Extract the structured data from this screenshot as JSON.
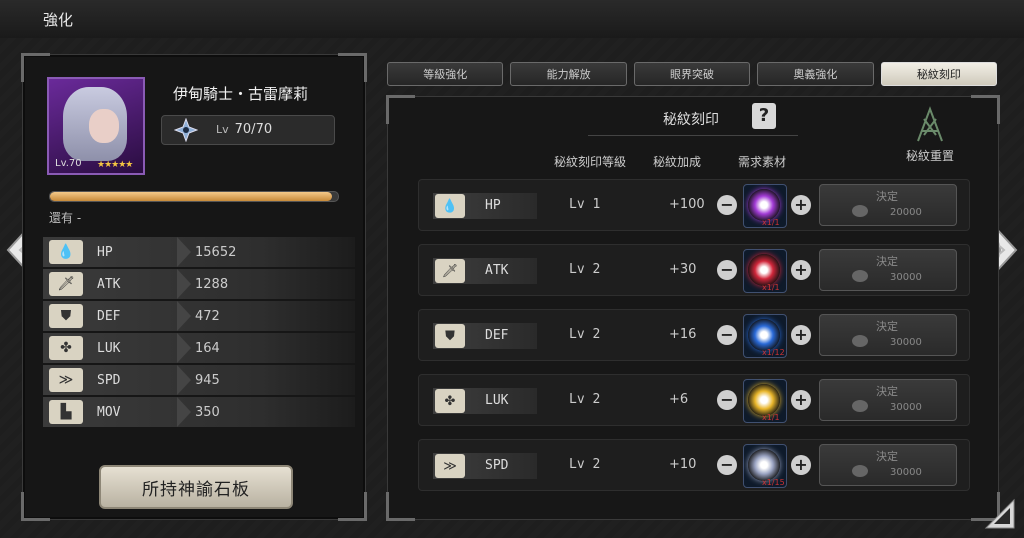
{
  "header": {
    "title": "強化"
  },
  "character": {
    "name": "伊甸騎士・古雷摩莉",
    "portrait_level": "Lv.70",
    "stars": "★★★★★",
    "level_prefix": "Lv",
    "level": "70/70",
    "xp_fraction": 0.98,
    "remain_label": "還有 -"
  },
  "stats": [
    {
      "icon": "hp-drop-icon",
      "glyph": "💧",
      "label": "HP",
      "value": "15652"
    },
    {
      "icon": "atk-sword-icon",
      "glyph": "🗡",
      "label": "ATK",
      "value": "1288"
    },
    {
      "icon": "def-shield-icon",
      "glyph": "⛊",
      "label": "DEF",
      "value": "472"
    },
    {
      "icon": "luk-clover-icon",
      "glyph": "✤",
      "label": "LUK",
      "value": "164"
    },
    {
      "icon": "spd-chevrons-icon",
      "glyph": "≫",
      "label": "SPD",
      "value": "945"
    },
    {
      "icon": "mov-boot-icon",
      "glyph": "▙",
      "label": "MOV",
      "value": "350"
    }
  ],
  "board_button": "所持神諭石板",
  "tabs": [
    {
      "label": "等級強化",
      "active": false
    },
    {
      "label": "能力解放",
      "active": false
    },
    {
      "label": "眼界突破",
      "active": false
    },
    {
      "label": "奧義強化",
      "active": false
    },
    {
      "label": "秘紋刻印",
      "active": true
    }
  ],
  "rune": {
    "title": "秘紋刻印",
    "help": "?",
    "reset_label": "秘紋重置",
    "col_level": "秘紋刻印等級",
    "col_bonus": "秘紋加成",
    "col_material": "需求素材",
    "rows": [
      {
        "glyph": "💧",
        "icon": "hp-drop-icon",
        "stat": "HP",
        "level": "Lv 1",
        "bonus": "+100",
        "orb": "#a23bd6",
        "count": "x1/1",
        "confirm": "決定",
        "cost": "20000"
      },
      {
        "glyph": "🗡",
        "icon": "atk-sword-icon",
        "stat": "ATK",
        "level": "Lv 2",
        "bonus": "+30",
        "orb": "#d0263a",
        "count": "x1/1",
        "confirm": "決定",
        "cost": "30000"
      },
      {
        "glyph": "⛊",
        "icon": "def-shield-icon",
        "stat": "DEF",
        "level": "Lv 2",
        "bonus": "+16",
        "orb": "#2a6ad8",
        "count": "x1/12",
        "confirm": "決定",
        "cost": "30000"
      },
      {
        "glyph": "✤",
        "icon": "luk-clover-icon",
        "stat": "LUK",
        "level": "Lv 2",
        "bonus": "+6",
        "orb": "#e8b52a",
        "count": "x1/1",
        "confirm": "決定",
        "cost": "30000"
      },
      {
        "glyph": "≫",
        "icon": "spd-chevrons-icon",
        "stat": "SPD",
        "level": "Lv 2",
        "bonus": "+10",
        "orb": "#9aa3c2",
        "count": "x1/15",
        "confirm": "決定",
        "cost": "30000"
      }
    ]
  }
}
